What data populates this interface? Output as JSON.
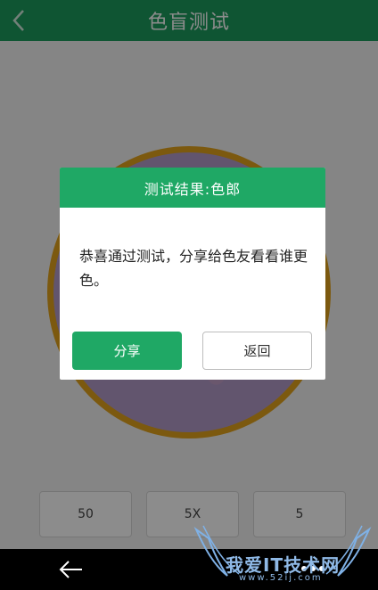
{
  "header": {
    "title": "色盲测试",
    "back_icon": "chevron-left-icon"
  },
  "answers": [
    "50",
    "5X",
    "5"
  ],
  "dialog": {
    "title": "测试结果:色郎",
    "message": "恭喜通过测试，分享给色友看看谁更色。",
    "share_label": "分享",
    "back_label": "返回"
  },
  "watermark": {
    "text": "我爱IT技术网",
    "sub": "www.52ij.com"
  },
  "colors": {
    "primary": "#1d9b5e",
    "accent": "#1fa865",
    "plate_ring": "#e2a31c"
  }
}
